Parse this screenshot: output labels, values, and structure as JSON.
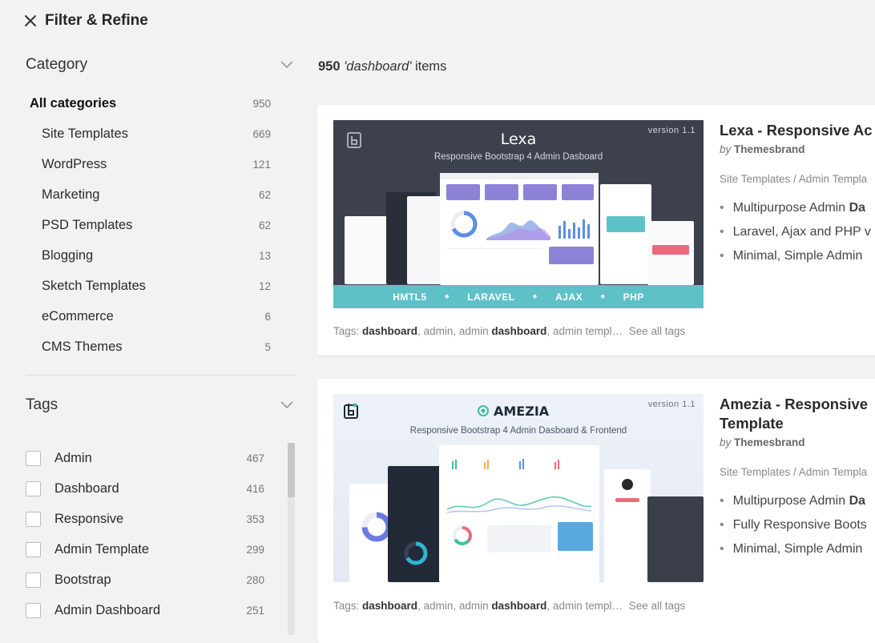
{
  "header": {
    "title": "Filter & Refine",
    "close_icon": "close-icon"
  },
  "sidebar": {
    "category": {
      "label": "Category",
      "items": [
        {
          "label": "All categories",
          "count": "950"
        },
        {
          "label": "Site Templates",
          "count": "669"
        },
        {
          "label": "WordPress",
          "count": "121"
        },
        {
          "label": "Marketing",
          "count": "62"
        },
        {
          "label": "PSD Templates",
          "count": "62"
        },
        {
          "label": "Blogging",
          "count": "13"
        },
        {
          "label": "Sketch Templates",
          "count": "12"
        },
        {
          "label": "eCommerce",
          "count": "6"
        },
        {
          "label": "CMS Themes",
          "count": "5"
        }
      ]
    },
    "tags": {
      "label": "Tags",
      "items": [
        {
          "label": "Admin",
          "count": "467"
        },
        {
          "label": "Dashboard",
          "count": "416"
        },
        {
          "label": "Responsive",
          "count": "353"
        },
        {
          "label": "Admin Template",
          "count": "299"
        },
        {
          "label": "Bootstrap",
          "count": "280"
        },
        {
          "label": "Admin Dashboard",
          "count": "251"
        }
      ]
    }
  },
  "results": {
    "count": "950",
    "query": "'dashboard'",
    "suffix": "items"
  },
  "items": [
    {
      "title": "Lexa - Responsive Ac",
      "by_prefix": "by",
      "author": "Themesbrand",
      "breadcrumb": "Site Templates / Admin Templa",
      "features": [
        {
          "pre": "Multipurpose Admin ",
          "bold": "Da"
        },
        {
          "pre": "Laravel, Ajax and PHP v",
          "bold": ""
        },
        {
          "pre": "Minimal, Simple Admin",
          "bold": ""
        }
      ],
      "tags_prefix": "Tags:",
      "tags": [
        "dashboard",
        "admin",
        "admin dashboard",
        "admin templ…"
      ],
      "see_all": "See all tags",
      "thumb": {
        "brand": "Lexa",
        "version": "version 1.1",
        "subtitle": "Responsive Bootstrap 4 Admin Dasboard",
        "stack": [
          "HMTL5",
          "LARAVEL",
          "AJAX",
          "PHP"
        ]
      }
    },
    {
      "title": "Amezia - Responsive",
      "title_line2": "Template",
      "by_prefix": "by",
      "author": "Themesbrand",
      "breadcrumb": "Site Templates / Admin Templa",
      "features": [
        {
          "pre": "Multipurpose Admin ",
          "bold": "Da"
        },
        {
          "pre": "Fully Responsive Boots",
          "bold": ""
        },
        {
          "pre": "Minimal, Simple Admin",
          "bold": ""
        }
      ],
      "tags_prefix": "Tags:",
      "tags": [
        "dashboard",
        "admin",
        "admin dashboard",
        "admin templ…"
      ],
      "see_all": "See all tags",
      "thumb": {
        "brand": "AMEZIA",
        "version": "version 1.1",
        "subtitle": "Responsive Bootstrap 4 Admin Dasboard & Frontend"
      }
    }
  ],
  "colors": {
    "page_bg": "#f2f2f2",
    "lexa_dark": "#3d414d",
    "lexa_teal": "#5fc1c8",
    "lexa_purple": "#8c83d6"
  }
}
